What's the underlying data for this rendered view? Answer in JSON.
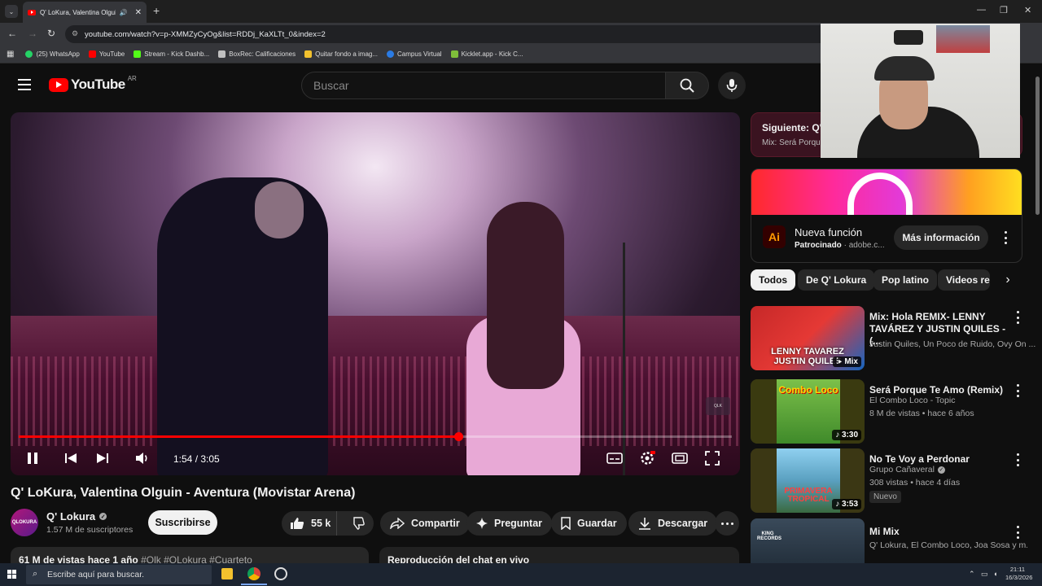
{
  "browser": {
    "tab_title": "Q' LoKura, Valentina Olguin",
    "url": "youtube.com/watch?v=p-XMMZyCyOg&list=RDDj_KaXLTt_0&index=2",
    "bookmarks": [
      "(25) WhatsApp",
      "YouTube",
      "Stream - Kick Dashb...",
      "BoxRec: Calificaciones",
      "Quitar fondo a imag...",
      "Campus Virtual",
      "Kicklet.app - Kick C..."
    ]
  },
  "youtube": {
    "logo_text": "YouTube",
    "country": "AR",
    "search_placeholder": "Buscar"
  },
  "player": {
    "time": "1:54 / 3:05",
    "progress": 0.617
  },
  "video": {
    "title": "Q' LoKura, Valentina Olguin - Aventura (Movistar Arena)",
    "channel": "Q' Lokura",
    "channel_avatar_text": "QLOKURA",
    "subscribers": "1.57 M de suscriptores",
    "subscribe_label": "Suscribirse",
    "likes": "55 k",
    "share_label": "Compartir",
    "ask_label": "Preguntar",
    "save_label": "Guardar",
    "download_label": "Descargar",
    "views_age": "61 M de vistas  hace 1 año",
    "hashtags": "#Qlk #QLokura #Cuarteto",
    "chat_replay": "Reproducción del chat en vivo"
  },
  "next_up": {
    "label": "Siguiente: Q' L",
    "sub": "Mix: Será Porque"
  },
  "ad": {
    "title": "Nueva función",
    "sponsored": "Patrocinado",
    "domain": "adobe.c...",
    "cta": "Más información",
    "logo": "Ai"
  },
  "chips": [
    "Todos",
    "De Q' Lokura",
    "Pop latino",
    "Videos re"
  ],
  "recommendations": [
    {
      "title": "Mix: Hola REMIX- LENNY TAVÁREZ Y JUSTIN QUILES - (...",
      "meta1": "Justin Quiles, Un Poco de Ruido, Ovy On ...",
      "badge": "Mix",
      "thumb_text": "LENNY TAVAREZ JUSTIN QUILES"
    },
    {
      "title": "Será Porque Te Amo (Remix)",
      "meta1": "El Combo Loco - Topic",
      "meta2": "8 M de vistas • hace 6 años",
      "duration": "3:30",
      "thumb_text": "Combo Loco"
    },
    {
      "title": "No Te Voy a Perdonar",
      "meta1": "Grupo Cañaveral",
      "meta2": "308 vistas • hace 4 días",
      "tag": "Nuevo",
      "duration": "3:53",
      "thumb_text": "PRIMAVERA TROPICAL"
    },
    {
      "title": "Mi Mix",
      "meta1": "Q' Lokura, El Combo Loco, Joa Sosa y m...",
      "thumb_text": "KING RECORDS"
    }
  ],
  "taskbar": {
    "search_placeholder": "Escribe aquí para buscar.",
    "time": "21:11",
    "date": "16/3/2026"
  },
  "colors": {
    "accent": "#ff0000",
    "background": "#0f0f0f",
    "chip_active": "#f1f1f1"
  }
}
